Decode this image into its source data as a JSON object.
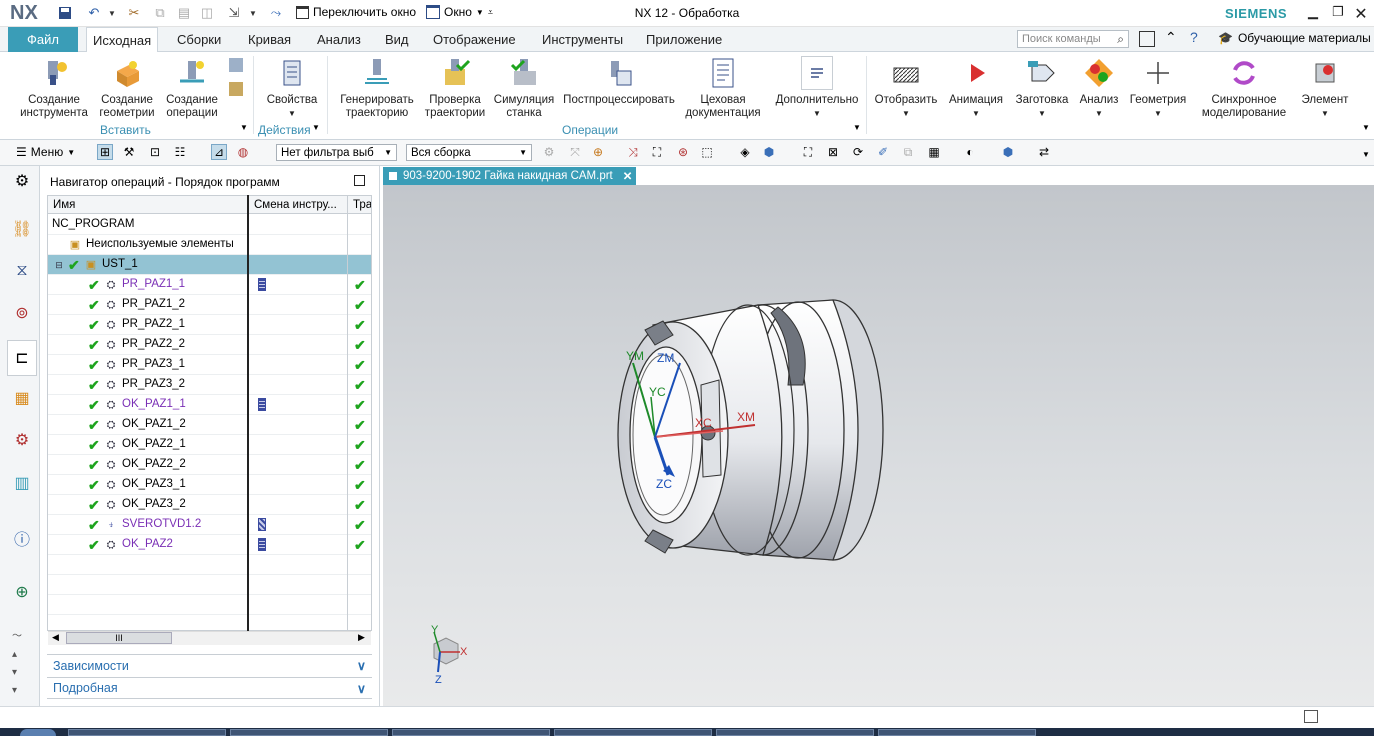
{
  "titlebar": {
    "logo": "NX",
    "switch_window": "Переключить окно",
    "window_menu": "Окно",
    "title": "NX 12 - Обработка",
    "brand": "SIEMENS"
  },
  "tabs": {
    "file": "Файл",
    "items": [
      "Исходная",
      "Сборки",
      "Кривая",
      "Анализ",
      "Вид",
      "Отображение",
      "Инструменты",
      "Приложение"
    ],
    "search_placeholder": "Поиск команды",
    "tutorial": "Обучающие материалы"
  },
  "ribbon": {
    "create_tool": "Создание инструмента",
    "create_geometry": "Создание геометрии",
    "create_operation": "Создание операции",
    "group_insert": "Вставить",
    "properties": "Свойства",
    "group_actions": "Действия",
    "generate_path": "Генерировать траекторию",
    "verify_path": "Проверка траектории",
    "machine_sim": "Симуляция станка",
    "postprocess": "Постпроцессировать",
    "shop_doc": "Цеховая документация",
    "more": "Дополнительно",
    "group_operations": "Операции",
    "display": "Отобразить",
    "animation": "Анимация",
    "blank": "Заготовка",
    "analysis": "Анализ",
    "geometry": "Геометрия",
    "sync_modeling": "Синхронное моделирование",
    "element": "Элемент"
  },
  "toolbar": {
    "menu": "Меню",
    "filter": "Нет фильтра выб",
    "assembly": "Вся сборка"
  },
  "navigator": {
    "title": "Навигатор операций - Порядок программ",
    "columns": [
      "Имя",
      "Смена инстру...",
      "Тра"
    ],
    "root": "NC_PROGRAM",
    "unused": "Неиспользуемые элементы",
    "group": "UST_1",
    "operations": [
      "PR_PAZ1_1",
      "PR_PAZ1_2",
      "PR_PAZ2_1",
      "PR_PAZ2_2",
      "PR_PAZ3_1",
      "PR_PAZ3_2",
      "OK_PAZ1_1",
      "OK_PAZ1_2",
      "OK_PAZ2_1",
      "OK_PAZ2_2",
      "OK_PAZ3_1",
      "OK_PAZ3_2",
      "SVEROTVD1.2",
      "OK_PAZ2"
    ],
    "scroll_thumb": "III",
    "dependencies": "Зависимости",
    "details": "Подробная"
  },
  "graphics": {
    "tab_title": "903-9200-1902 Гайка накидная CAM.prt",
    "close": "✕",
    "axis_labels": {
      "ym": "YM",
      "zm": "ZM",
      "yc": "YC",
      "xc": "XC",
      "xm": "XM",
      "zc": "ZC"
    },
    "triad": {
      "x": "X",
      "y": "Y",
      "z": "Z"
    }
  },
  "colors": {
    "accent": "#3a9db7",
    "brand": "#2b9aa6",
    "selected_row": "#93c3d3",
    "check": "#1ea41e",
    "tool_change": "#7a2fb5"
  }
}
